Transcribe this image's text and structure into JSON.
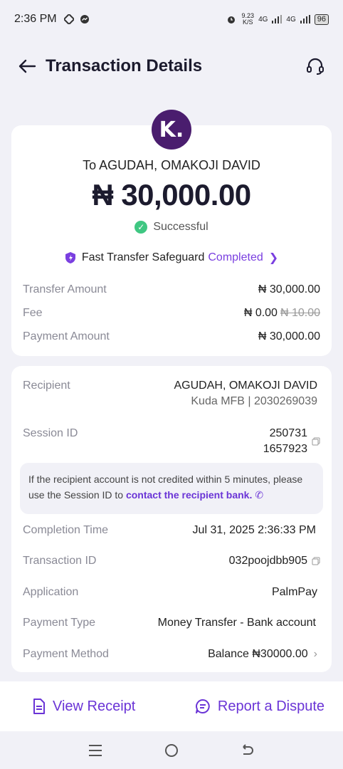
{
  "status_bar": {
    "time": "2:36 PM",
    "net_speed_value": "9.23",
    "net_speed_unit": "K/S",
    "signal1": "4G",
    "signal2": "4G",
    "battery": "96"
  },
  "header": {
    "title": "Transaction Details"
  },
  "summary": {
    "logo_letter": "K.",
    "recipient_line": "To AGUDAH, OMAKOJI DAVID",
    "amount": "₦ 30,000.00",
    "status": "Successful",
    "safeguard_label": "Fast Transfer Safeguard",
    "safeguard_status": "Completed",
    "transfer_amount_label": "Transfer Amount",
    "transfer_amount_value": "₦ 30,000.00",
    "fee_label": "Fee",
    "fee_value": "₦ 0.00",
    "fee_original": "₦ 10.00",
    "payment_amount_label": "Payment Amount",
    "payment_amount_value": "₦ 30,000.00"
  },
  "details": {
    "recipient_label": "Recipient",
    "recipient_name": "AGUDAH, OMAKOJI DAVID",
    "recipient_bank": "Kuda MFB | 2030269039",
    "session_label": "Session ID",
    "session_line1": "250731",
    "session_line2": "1657923",
    "notice_text": "If the recipient account is not credited within 5 minutes, please use the Session ID to",
    "notice_link": "contact the recipient bank.",
    "completion_label": "Completion Time",
    "completion_value": "Jul 31, 2025 2:36:33 PM",
    "txn_label": "Transaction ID",
    "txn_value": "032poojdbb905",
    "app_label": "Application",
    "app_value": "PalmPay",
    "payment_type_label": "Payment Type",
    "payment_type_value": "Money Transfer - Bank account",
    "payment_method_label": "Payment Method",
    "payment_method_value": "Balance ₦30000.00"
  },
  "actions": {
    "view_receipt": "View Receipt",
    "report_dispute": "Report a Dispute"
  },
  "colors": {
    "accent": "#6a34d6",
    "success": "#3fc782",
    "kuda": "#4a1d6e"
  }
}
